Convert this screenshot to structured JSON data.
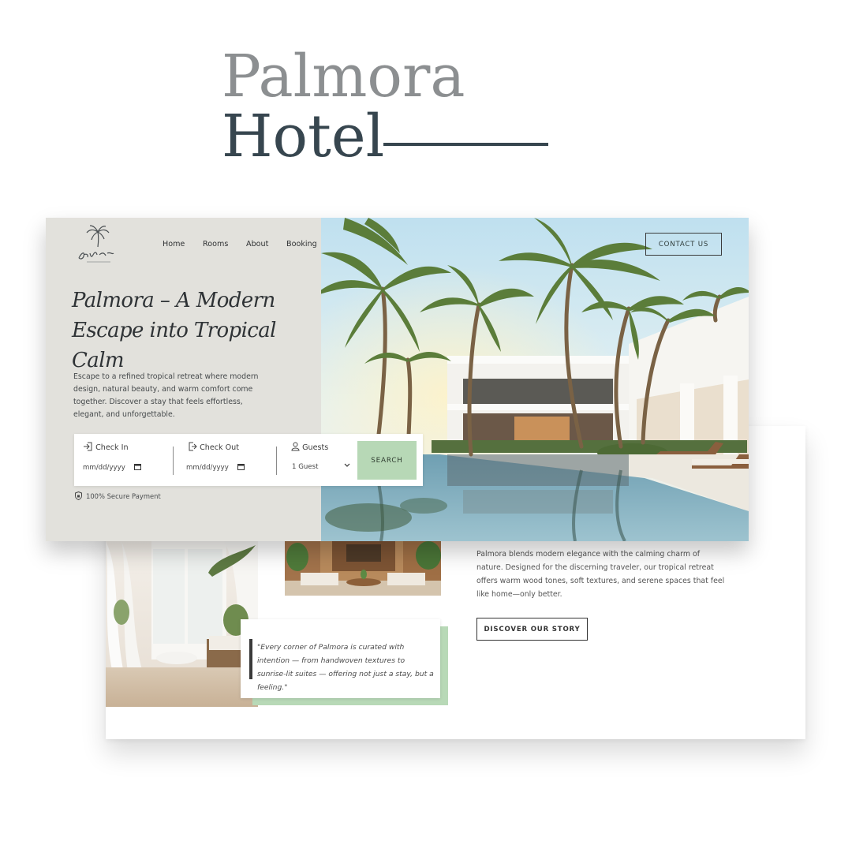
{
  "title": {
    "line1": "Palmora",
    "line2": "Hotel"
  },
  "brand": {
    "logo_text": "palmora",
    "logo_tagline": "luxury & resort"
  },
  "nav": {
    "items": [
      "Home",
      "Rooms",
      "About",
      "Booking"
    ],
    "contact": "CONTACT US"
  },
  "hero": {
    "headline": "Palmora – A Modern Escape into Tropical Calm",
    "intro": "Escape to a refined tropical retreat where modern design, natural beauty, and warm comfort come together. Discover a stay that feels effortless, elegant, and unforgettable."
  },
  "booking": {
    "checkin_label": "Check In",
    "checkin_value": "mm/dd/yyyy",
    "checkout_label": "Check Out",
    "checkout_value": "mm/dd/yyyy",
    "guests_label": "Guests",
    "guests_value": "1 Guest",
    "search": "SEARCH",
    "secure": "100% Secure Payment"
  },
  "about": {
    "text": "Palmora blends modern elegance with the calming charm of nature. Designed for the discerning traveler, our tropical retreat offers warm wood tones, soft textures, and serene spaces that feel like home—only better.",
    "button": "DISCOVER OUR STORY",
    "quote": "\"Every corner of Palmora is curated with intention — from handwoven textures to sunrise-lit suites — offering not just a stay, but a feeling.\""
  },
  "colors": {
    "accent_green": "#b7d8b6",
    "title_dark": "#37464f",
    "title_light": "#8c8f91",
    "panel": "#e2e1dc"
  }
}
